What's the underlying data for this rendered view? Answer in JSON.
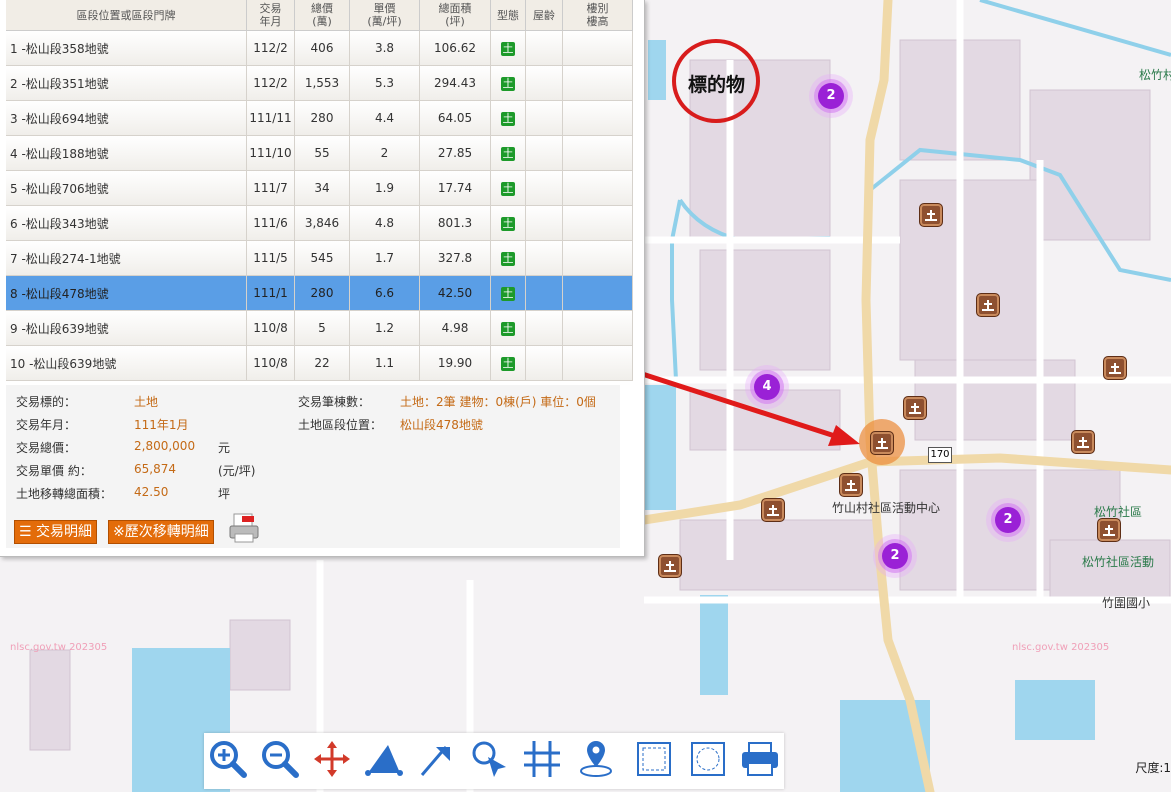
{
  "table": {
    "headers": [
      "區段位置或區段門牌",
      "交易\n年月",
      "總價\n(萬)",
      "單價\n(萬/坪)",
      "總面積\n(坪)",
      "型態",
      "屋齡",
      "樓別\n樓高"
    ],
    "rows": [
      {
        "addr": "1 -松山段358地號",
        "date": "112/2",
        "total": "406",
        "unit": "3.8",
        "area": "106.62",
        "type": "土"
      },
      {
        "addr": "2 -松山段351地號",
        "date": "112/2",
        "total": "1,553",
        "unit": "5.3",
        "area": "294.43",
        "type": "土"
      },
      {
        "addr": "3 -松山段694地號",
        "date": "111/11",
        "total": "280",
        "unit": "4.4",
        "area": "64.05",
        "type": "土"
      },
      {
        "addr": "4 -松山段188地號",
        "date": "111/10",
        "total": "55",
        "unit": "2",
        "area": "27.85",
        "type": "土"
      },
      {
        "addr": "5 -松山段706地號",
        "date": "111/7",
        "total": "34",
        "unit": "1.9",
        "area": "17.74",
        "type": "土"
      },
      {
        "addr": "6 -松山段343地號",
        "date": "111/6",
        "total": "3,846",
        "unit": "4.8",
        "area": "801.3",
        "type": "土"
      },
      {
        "addr": "7 -松山段274-1地號",
        "date": "111/5",
        "total": "545",
        "unit": "1.7",
        "area": "327.8",
        "type": "土"
      },
      {
        "addr": "8 -松山段478地號",
        "date": "111/1",
        "total": "280",
        "unit": "6.6",
        "area": "42.50",
        "type": "土"
      },
      {
        "addr": "9 -松山段639地號",
        "date": "110/8",
        "total": "5",
        "unit": "1.2",
        "area": "4.98",
        "type": "土"
      },
      {
        "addr": "10 -松山段639地號",
        "date": "110/8",
        "total": "22",
        "unit": "1.1",
        "area": "19.90",
        "type": "土"
      }
    ]
  },
  "detail": {
    "target_label": "交易標的：",
    "target_value": "土地",
    "date_label": "交易年月：",
    "date_value": "111年1月",
    "total_label": "交易總價：",
    "total_value": "2,800,000",
    "total_unit": "元",
    "unit_label": "交易單價 約：",
    "unit_value": "65,874",
    "unit_unit": "(元/坪)",
    "area_label": "土地移轉總面積：",
    "area_value": "42.50",
    "area_unit": "坪",
    "count_label": "交易筆棟數：",
    "count_value": "土地：2筆 建物：0棟(戶) 車位：0個",
    "location_label": "土地區段位置：",
    "location_value": "松山段478地號",
    "btn_detail": "交易明細",
    "btn_history": "※歷次移轉明細"
  },
  "map": {
    "landmark_label": "標的物",
    "road_number": "170",
    "place_labels": {
      "community_center": "竹山村社區活動中心",
      "songzhu_community": "松竹社區",
      "songzhu_activity": "松竹社區活動",
      "zhuwei_school": "竹圍國小",
      "songzhu_village": "松竹村"
    },
    "clusters": [
      "2",
      "4",
      "2",
      "2"
    ],
    "land_marker_char": "土",
    "watermark": "nlsc.gov.tw 202305",
    "scale_label": "尺度:1"
  },
  "toolbar": {
    "tools": [
      "zoom-in-icon",
      "zoom-out-icon",
      "pan-icon",
      "measure-area-icon",
      "measure-distance-icon",
      "select-icon",
      "grid-icon",
      "locate-icon",
      "frame-icon",
      "frame-dashed-icon",
      "print-icon"
    ]
  },
  "colors": {
    "selected_row": "#5a9ee6",
    "value_text": "#c46a16",
    "button": "#e36c0a",
    "land_marker": "#8e5030",
    "cluster": "#9a21d6",
    "annotation_red": "#d81c1c"
  }
}
